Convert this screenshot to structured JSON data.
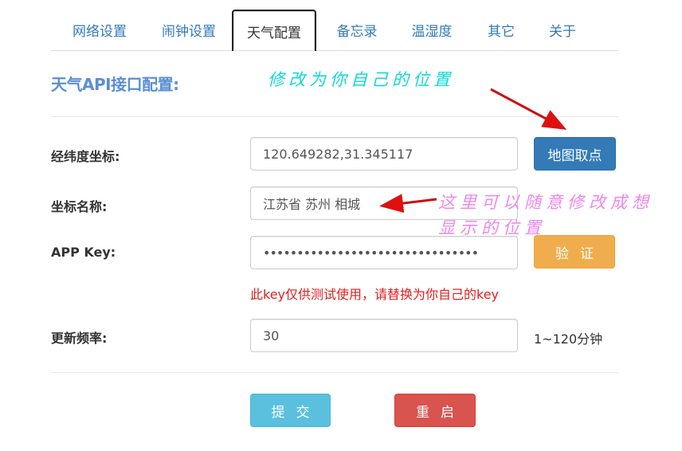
{
  "tabs": [
    {
      "label": "网络设置"
    },
    {
      "label": "闹钟设置"
    },
    {
      "label": "天气配置"
    },
    {
      "label": "备忘录"
    },
    {
      "label": "温湿度"
    },
    {
      "label": "其它"
    },
    {
      "label": "关于"
    }
  ],
  "active_tab": "天气配置",
  "section_title": "天气API接口配置:",
  "form": {
    "coords": {
      "label": "经纬度坐标:",
      "value": "120.649282,31.345117"
    },
    "map_button": "地图取点",
    "location": {
      "label": "坐标名称:",
      "value": "江苏省 苏州 相城"
    },
    "app_key": {
      "label": "APP Key:",
      "value": "••••••••••••••••••••••••••••••••"
    },
    "verify_button": "验证",
    "key_warning": "此key仅供测试使用，请替换为你自己的key",
    "refresh": {
      "label": "更新频率:",
      "value": "30",
      "unit": "1~120分钟"
    },
    "submit_button": "提交",
    "restart_button": "重启"
  },
  "annotations": {
    "top": "修改为你自己的位置",
    "side_line1": "这里可以随意修改成想",
    "side_line2": "显示的位置"
  },
  "colors": {
    "link": "#337ab7",
    "title": "#5b8fd6",
    "warning_text": "#e02020",
    "annotation_cyan": "#12d8d8",
    "annotation_pink": "#ee88ee",
    "arrow": "#e01010"
  }
}
